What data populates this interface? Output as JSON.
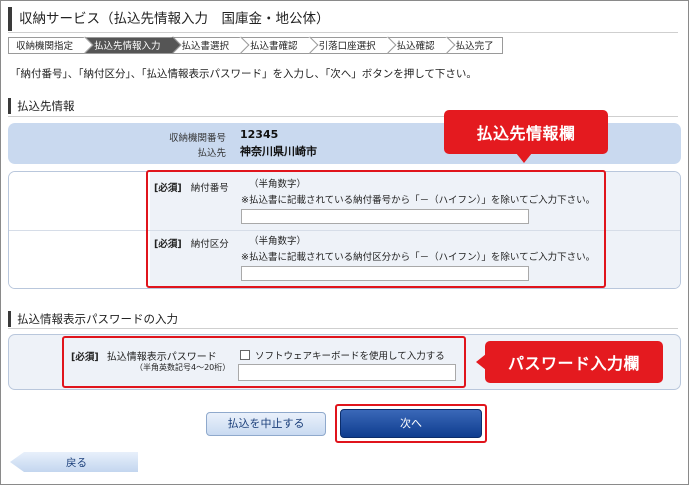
{
  "page": {
    "title": "収納サービス（払込先情報入力　国庫金・地公体）",
    "instruction": "「納付番号」、「納付区分」、「払込情報表示パスワード」を入力し、「次へ」ボタンを押して下さい。"
  },
  "steps": [
    {
      "label": "収納機関指定",
      "active": false
    },
    {
      "label": "払込先情報入力",
      "active": true
    },
    {
      "label": "払込書選択",
      "active": false
    },
    {
      "label": "払込書確認",
      "active": false
    },
    {
      "label": "引落口座選択",
      "active": false
    },
    {
      "label": "払込確認",
      "active": false
    },
    {
      "label": "払込完了",
      "active": false
    }
  ],
  "payee_section": {
    "heading": "払込先情報",
    "agency_number_label": "収納機関番号",
    "agency_number_value": "12345",
    "payee_label": "払込先",
    "payee_value": "神奈川県川崎市"
  },
  "form": {
    "payment_number": {
      "required": "[必須]",
      "label": "納付番号",
      "hint_type": "（半角数字）",
      "hint_text": "※払込書に記載されている納付番号から「－（ハイフン）」を除いてご入力下さい。",
      "value": ""
    },
    "payment_category": {
      "required": "[必須]",
      "label": "納付区分",
      "hint_type": "（半角数字）",
      "hint_text": "※払込書に記載されている納付区分から「－（ハイフン）」を除いてご入力下さい。",
      "value": ""
    }
  },
  "password_section": {
    "heading": "払込情報表示パスワードの入力",
    "required": "[必須]",
    "label": "払込情報表示パスワード",
    "sub_label": "（半角英数記号4～20桁）",
    "checkbox_label": "ソフトウェアキーボードを使用して入力する",
    "checkbox_checked": false,
    "value": ""
  },
  "callouts": {
    "payee_info": "払込先情報欄",
    "password": "パスワード入力欄"
  },
  "buttons": {
    "cancel": "払込を中止する",
    "next": "次へ",
    "back": "戻る"
  },
  "colors": {
    "accent_red": "#e41a1f",
    "next_button": "#0f3d8f",
    "payee_bg": "#c9d9ef"
  }
}
